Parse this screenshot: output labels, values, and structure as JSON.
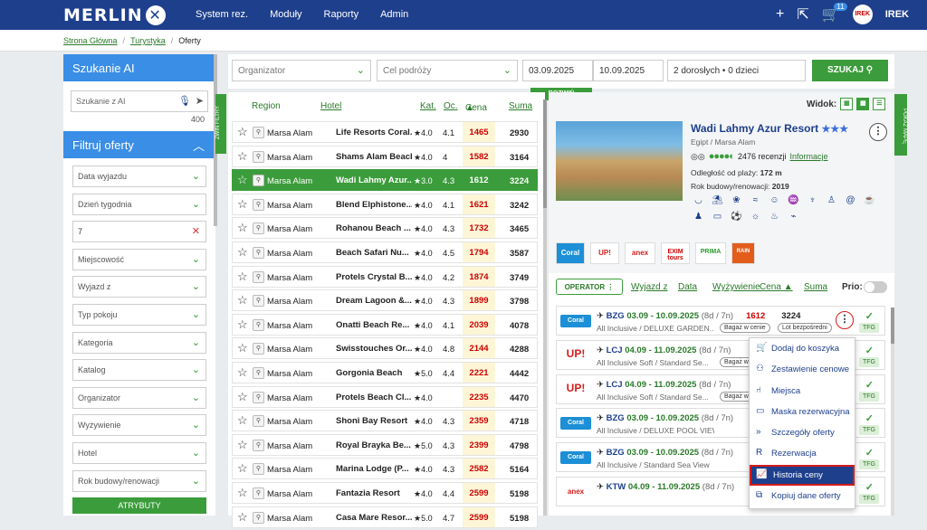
{
  "brand": "MERLIN",
  "nav": [
    "System rez.",
    "Moduły",
    "Raporty",
    "Admin"
  ],
  "cart_count": "11",
  "user": {
    "name": "IREK",
    "avatar": "IREK"
  },
  "breadcrumbs": [
    "Strona Główna",
    "Turystyka",
    "Oferty"
  ],
  "sidebar": {
    "ai_title": "Szukanie AI",
    "ai_placeholder": "Szukanie z AI",
    "ai_count": "400",
    "filter_title": "Filtruj oferty",
    "filters": [
      "Data wyjazdu",
      "Dzień tygodnia",
      "7",
      "Miejscowość",
      "Wyjazd z",
      "Typ pokoju",
      "Kategoria",
      "Katalog",
      "Organizator",
      "Wyżywienie",
      "Hotel",
      "Rok budowy/renowacji"
    ],
    "atrybuty": "ATRYBUTY"
  },
  "tabs": {
    "zwin": "ZWIŃ FILTRY",
    "pokaz": "POKAŻ MAPĘ"
  },
  "search": {
    "organizator": "Organizator",
    "cel": "Cel podróży",
    "date_from": "03.09.2025",
    "date_to": "10.09.2025",
    "people": "2 dorosłych • 0 dzieci",
    "szukaj": "SZUKAJ",
    "rozwin": "ROZWIŃ"
  },
  "list_headers": {
    "region": "Region",
    "hotel": "Hotel",
    "kat": "Kat.",
    "oc": "Oc.",
    "cena": "Cena",
    "suma": "Suma"
  },
  "hotels": [
    {
      "region": "Marsa Alam",
      "hotel": "Life Resorts Coral...",
      "kat": "4.0",
      "oc": "4.1",
      "cena": "1465",
      "suma": "2930"
    },
    {
      "region": "Marsa Alam",
      "hotel": "Shams Alam Beach...",
      "kat": "4.0",
      "oc": "4",
      "cena": "1582",
      "suma": "3164"
    },
    {
      "region": "Marsa Alam",
      "hotel": "Wadi Lahmy Azur...",
      "kat": "3.0",
      "oc": "4.3",
      "cena": "1612",
      "suma": "3224"
    },
    {
      "region": "Marsa Alam",
      "hotel": "Blend Elphistone...",
      "kat": "4.0",
      "oc": "4.1",
      "cena": "1621",
      "suma": "3242"
    },
    {
      "region": "Marsa Alam",
      "hotel": "Rohanou Beach ...",
      "kat": "4.0",
      "oc": "4.3",
      "cena": "1732",
      "suma": "3465"
    },
    {
      "region": "Marsa Alam",
      "hotel": "Beach Safari Nu...",
      "kat": "4.0",
      "oc": "4.5",
      "cena": "1794",
      "suma": "3587"
    },
    {
      "region": "Marsa Alam",
      "hotel": "Protels Crystal B...",
      "kat": "4.0",
      "oc": "4.2",
      "cena": "1874",
      "suma": "3749"
    },
    {
      "region": "Marsa Alam",
      "hotel": "Dream Lagoon &...",
      "kat": "4.0",
      "oc": "4.3",
      "cena": "1899",
      "suma": "3798"
    },
    {
      "region": "Marsa Alam",
      "hotel": "Onatti Beach Re...",
      "kat": "4.0",
      "oc": "4.1",
      "cena": "2039",
      "suma": "4078"
    },
    {
      "region": "Marsa Alam",
      "hotel": "Swisstouches Or...",
      "kat": "4.0",
      "oc": "4.8",
      "cena": "2144",
      "suma": "4288"
    },
    {
      "region": "Marsa Alam",
      "hotel": "Gorgonia Beach",
      "kat": "5.0",
      "oc": "4.4",
      "cena": "2221",
      "suma": "4442"
    },
    {
      "region": "Marsa Alam",
      "hotel": "Protels Beach Cl...",
      "kat": "4.0",
      "oc": "",
      "cena": "2235",
      "suma": "4470"
    },
    {
      "region": "Marsa Alam",
      "hotel": "Shoni Bay Resort",
      "kat": "4.0",
      "oc": "4.3",
      "cena": "2359",
      "suma": "4718"
    },
    {
      "region": "Marsa Alam",
      "hotel": "Royal Brayka Be...",
      "kat": "5.0",
      "oc": "4.3",
      "cena": "2399",
      "suma": "4798"
    },
    {
      "region": "Marsa Alam",
      "hotel": "Marina Lodge (P...",
      "kat": "4.0",
      "oc": "4.3",
      "cena": "2582",
      "suma": "5164"
    },
    {
      "region": "Marsa Alam",
      "hotel": "Fantazia Resort",
      "kat": "4.0",
      "oc": "4.4",
      "cena": "2599",
      "suma": "5198"
    },
    {
      "region": "Marsa Alam",
      "hotel": "Casa Mare Resor...",
      "kat": "5.0",
      "oc": "4.7",
      "cena": "2599",
      "suma": "5198"
    }
  ],
  "detail": {
    "widok": "Widok:",
    "name": "Wadi Lahmy Azur Resort",
    "stars": "★★★",
    "location": "Egipt / Marsa Alam",
    "reviews": "2476 recenzji",
    "info": "Informacje",
    "beach_label": "Odległość od plaży:",
    "beach": "172 m",
    "build_label": "Rok budowy/renowacji:",
    "build": "2019",
    "operators": [
      "Coral",
      "UP!",
      "anex",
      "EXIM tours",
      "PRIMA",
      "RAIN"
    ]
  },
  "offers_head": {
    "operator": "OPERATOR",
    "wyjazd": "Wyjazd z",
    "data": "Data",
    "wyzyw": "Wyżywienie",
    "cena": "Cena",
    "suma": "Suma",
    "prio": "Prio:"
  },
  "offers": [
    {
      "op": "Coral",
      "ap": "BZG",
      "dates": "03.09 - 10.09.2025",
      "dur": "(8d / 7n)",
      "price": "1612",
      "sum": "3224",
      "desc": "All Inclusive / DELUXE GARDEN...",
      "tags": [
        "Bagaż w cenie",
        "Lot bezpośredni"
      ]
    },
    {
      "op": "UP!",
      "ap": "LCJ",
      "dates": "04.09 - 11.09.2025",
      "dur": "(8d / 7n)",
      "price": "",
      "sum": "",
      "desc": "All Inclusive Soft / Standard Se...",
      "tags": [
        "Bagaż w cenie"
      ]
    },
    {
      "op": "UP!",
      "ap": "LCJ",
      "dates": "04.09 - 11.09.2025",
      "dur": "(8d / 7n)",
      "price": "",
      "sum": "",
      "desc": "All Inclusive Soft / Standard Se...",
      "tags": [
        "Bagaż w cenie"
      ]
    },
    {
      "op": "Coral",
      "ap": "BZG",
      "dates": "03.09 - 10.09.2025",
      "dur": "(8d / 7n)",
      "price": "",
      "sum": "",
      "desc": "All Inclusive / DELUXE POOL VIEW ROOM",
      "tags": []
    },
    {
      "op": "Coral",
      "ap": "BZG",
      "dates": "03.09 - 10.09.2025",
      "dur": "(8d / 7n)",
      "price": "",
      "sum": "",
      "desc": "All Inclusive / Standard Sea View",
      "tags": []
    },
    {
      "op": "anex",
      "ap": "KTW",
      "dates": "04.09 - 11.09.2025",
      "dur": "(8d / 7n)",
      "price": "",
      "sum": "",
      "desc": "",
      "tags": []
    }
  ],
  "menu": [
    "Dodaj do koszyka",
    "Zestawienie cenowe",
    "Miejsca",
    "Maska rezerwacyjna",
    "Szczegóły oferty",
    "Rezerwacja",
    "Historia ceny",
    "Kopiuj dane oferty"
  ],
  "tfg": "TFG"
}
